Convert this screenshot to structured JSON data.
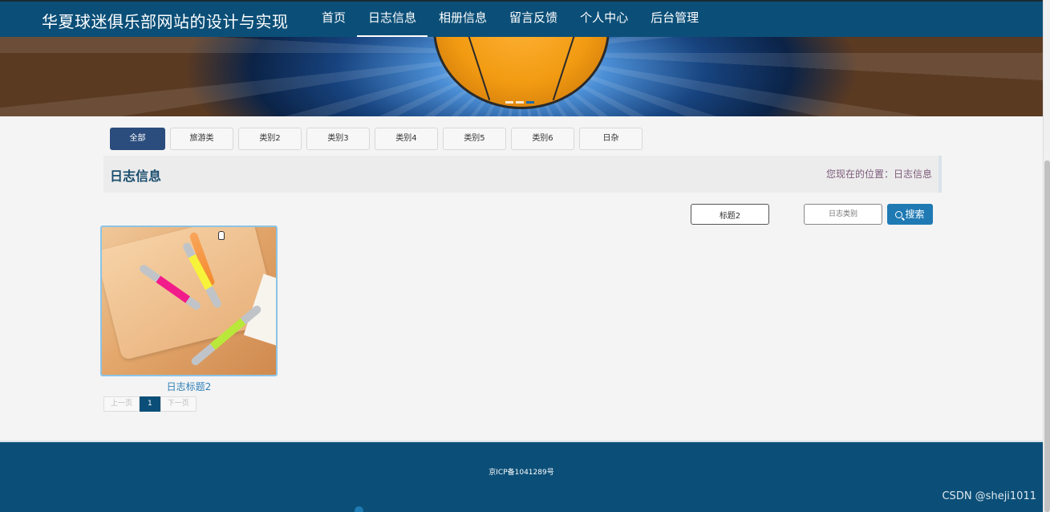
{
  "header": {
    "site_title": "华夏球迷俱乐部网站的设计与实现",
    "nav": [
      {
        "label": "首页",
        "active": false
      },
      {
        "label": "日志信息",
        "active": true
      },
      {
        "label": "相册信息",
        "active": false
      },
      {
        "label": "留言反馈",
        "active": false
      },
      {
        "label": "个人中心",
        "active": false
      },
      {
        "label": "后台管理",
        "active": false
      }
    ]
  },
  "categories": [
    "全部",
    "旅游类",
    "类别2",
    "类别3",
    "类别4",
    "类别5",
    "类别6",
    "日杂"
  ],
  "active_category": "全部",
  "section": {
    "title": "日志信息",
    "breadcrumb": "您现在的位置：日志信息"
  },
  "search": {
    "title_value": "标题2",
    "category_placeholder": "日志类别",
    "button_label": "搜索"
  },
  "cards": [
    {
      "title": "日志标题2"
    }
  ],
  "pagination": {
    "prev": "上一页",
    "current": "1",
    "next": "下一页"
  },
  "footer": {
    "icp": "京ICP备1041289号"
  },
  "watermark": "CSDN @sheji1011"
}
